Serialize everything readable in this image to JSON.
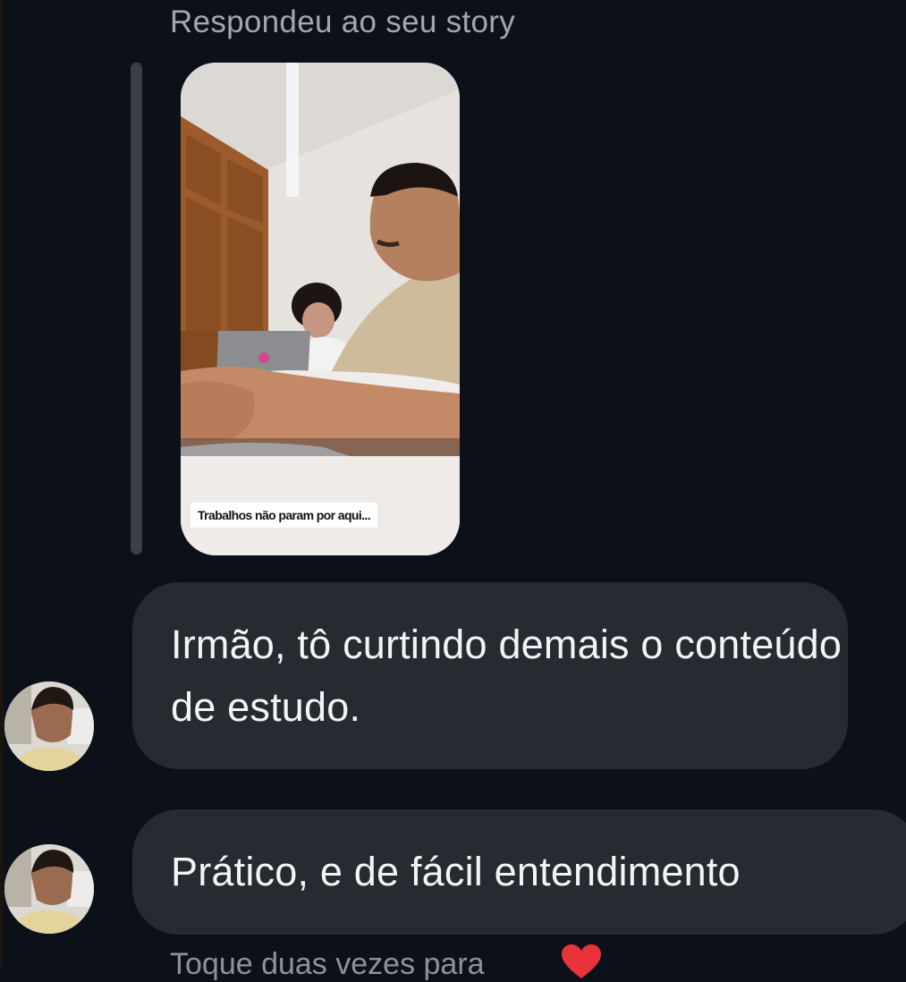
{
  "story_reply": {
    "label": "Respondeu ao seu story",
    "caption": "Trabalhos não param por aqui..."
  },
  "messages": [
    {
      "text": "Irmão, tô curtindo demais o conteúdo de estudo."
    },
    {
      "text": "Prático, e de fácil entendimento"
    }
  ],
  "hint": {
    "text": "Toque duas vezes para",
    "icon": "heart-icon"
  },
  "colors": {
    "background": "#0b1019",
    "bubble": "#262a31",
    "heart": "#e8333a"
  }
}
